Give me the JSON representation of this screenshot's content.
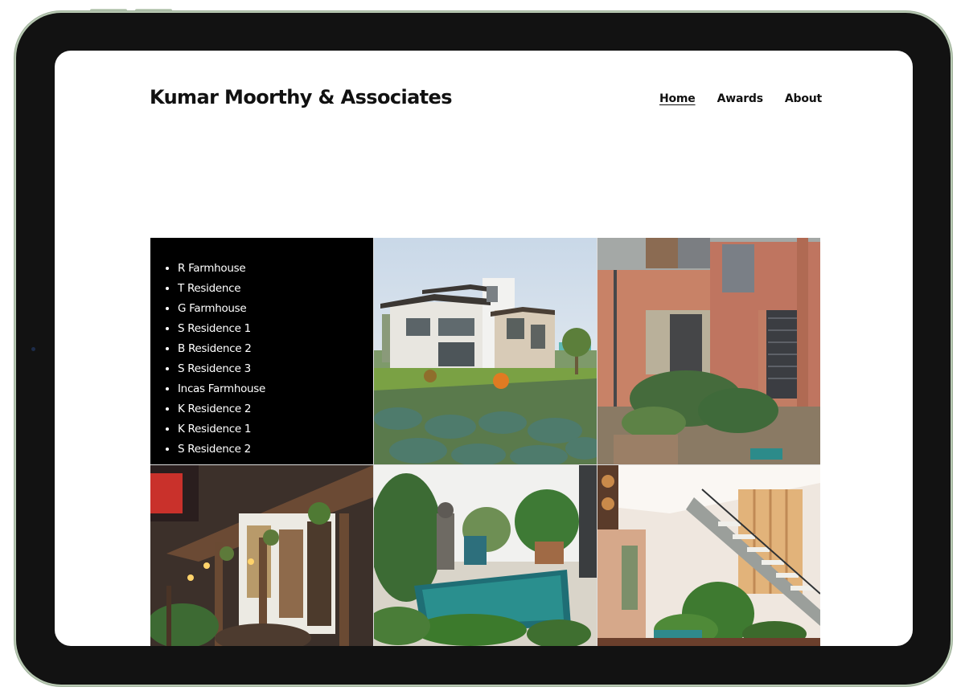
{
  "site": {
    "title": "Kumar Moorthy & Associates"
  },
  "nav": [
    {
      "label": "Home",
      "active": true
    },
    {
      "label": "Awards",
      "active": false
    },
    {
      "label": "About",
      "active": false
    }
  ],
  "projects": [
    "R Farmhouse",
    "T Residence",
    "G Farmhouse",
    "S Residence 1",
    "B Residence 2",
    "S Residence 3",
    "Incas Farmhouse",
    "K Residence 2",
    "K Residence 1",
    "S Residence 2"
  ],
  "colors": {
    "device_frame": "#121212",
    "device_rim": "#b8c9b3",
    "list_background": "#000000",
    "text": "#111111"
  },
  "photos": [
    {
      "icon": "house-exterior-photo"
    },
    {
      "icon": "brick-courtyard-photo"
    },
    {
      "icon": "veranda-lanterns-photo"
    },
    {
      "icon": "buddha-pool-photo"
    },
    {
      "icon": "staircase-garden-photo"
    }
  ]
}
